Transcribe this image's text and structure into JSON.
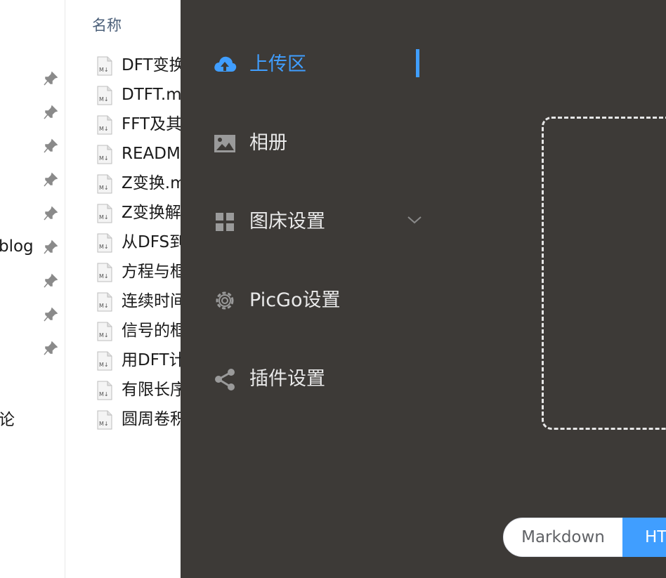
{
  "explorer": {
    "quick_access": {
      "labels": [
        "blog",
        "论"
      ]
    },
    "column_header": "名称",
    "files": [
      "DFT变换",
      "DTFT.m",
      "FFT及其",
      "READM",
      "Z变换.m",
      "Z变换解",
      "从DFS到",
      "方程与框",
      "连续时间",
      "信号的框",
      "用DFT计",
      "有限长序",
      "圆周卷积"
    ]
  },
  "picgo": {
    "menu": [
      {
        "label": "上传区",
        "icon": "cloud-upload-icon",
        "active": true
      },
      {
        "label": "相册",
        "icon": "picture-icon"
      },
      {
        "label": "图床设置",
        "icon": "grid-icon",
        "has_submenu": true
      },
      {
        "label": "PicGo设置",
        "icon": "gear-icon"
      },
      {
        "label": "插件设置",
        "icon": "share-icon"
      }
    ],
    "format_toggle": {
      "markdown": "Markdown",
      "html": "HTML"
    },
    "colors": {
      "accent": "#409eff",
      "panel_bg": "#3d3a37",
      "menu_text": "#e9e9e9"
    }
  }
}
